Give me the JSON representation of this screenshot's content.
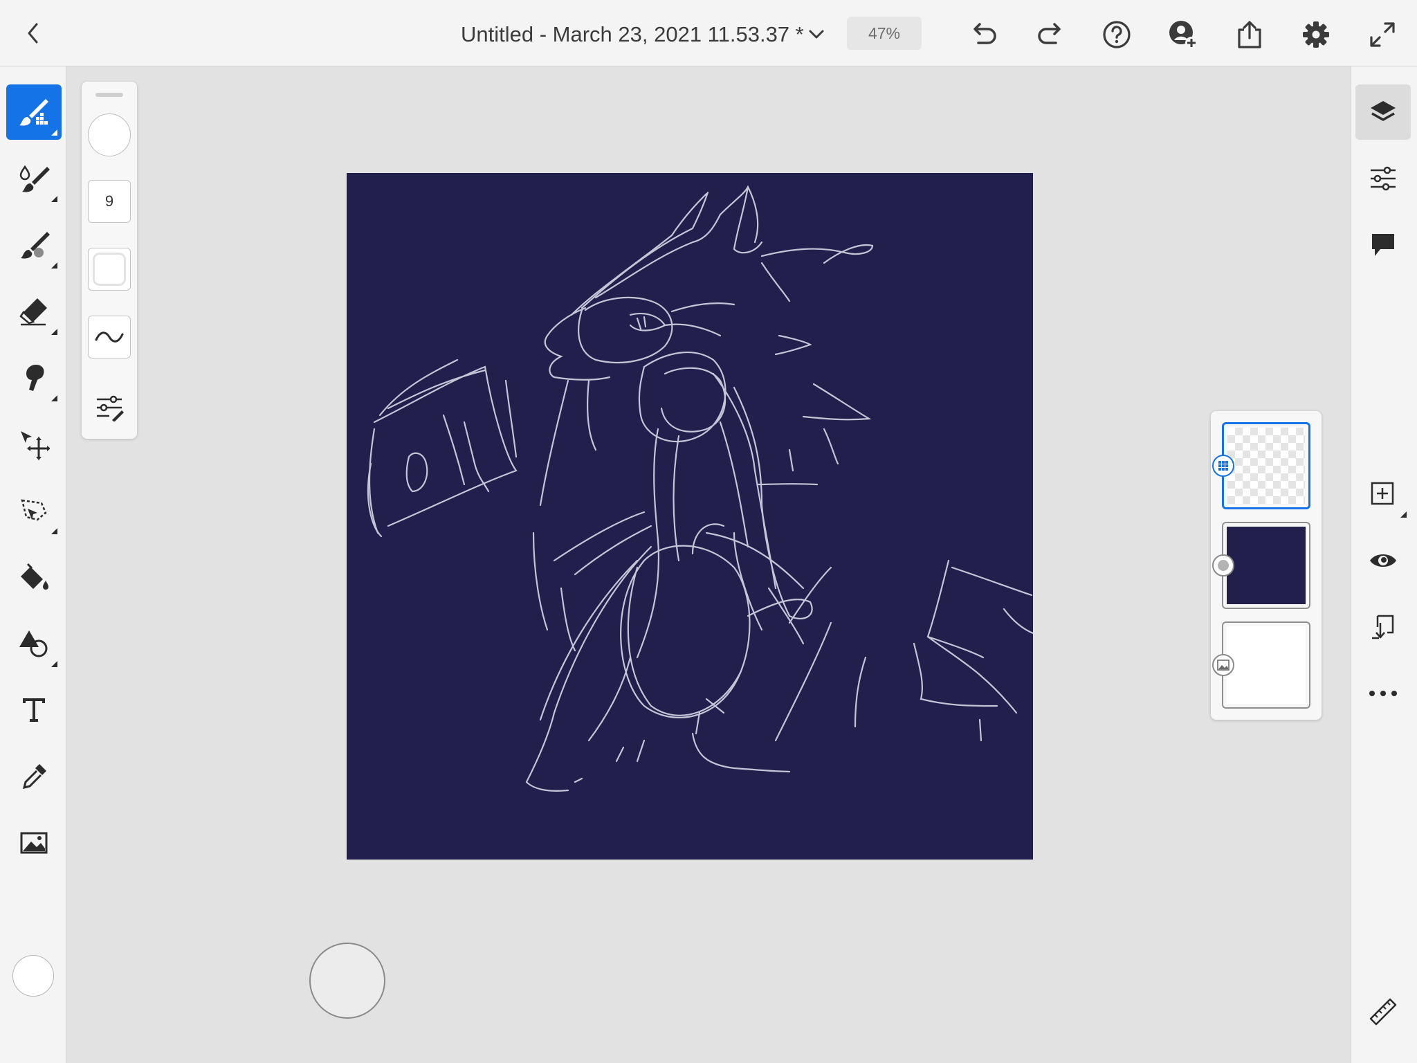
{
  "app": {
    "document_title": "Untitled - March 23, 2021 11.53.37 *",
    "zoom_level": "47%",
    "accent_color": "#1473e6",
    "canvas_color": "#221f4d"
  },
  "header": {
    "icons": [
      "back-icon",
      "chevron-down-icon",
      "undo-icon",
      "redo-icon",
      "help-icon",
      "invite-icon",
      "share-icon",
      "settings-icon",
      "fullscreen-icon"
    ]
  },
  "left_toolbar": {
    "tools": [
      "pixel-brush",
      "live-brush",
      "vector-brush",
      "eraser",
      "smudge",
      "transform",
      "selection",
      "fill",
      "shapes",
      "type",
      "eyedropper",
      "place-image"
    ],
    "active_tool": "pixel-brush",
    "current_color": "#ffffff"
  },
  "brush_panel": {
    "size_value": "9"
  },
  "right_toolbar": {
    "icons": [
      "layers-icon",
      "layer-properties-icon",
      "comments-icon",
      "add-layer-icon",
      "visibility-icon",
      "merge-down-icon",
      "more-icon",
      "ruler-icon"
    ]
  },
  "layers": [
    {
      "kind": "pixel",
      "content": "transparent",
      "selected": true
    },
    {
      "kind": "fill",
      "content": "#221f4d",
      "selected": false
    },
    {
      "kind": "image",
      "content": "#ffffff",
      "selected": false
    }
  ]
}
